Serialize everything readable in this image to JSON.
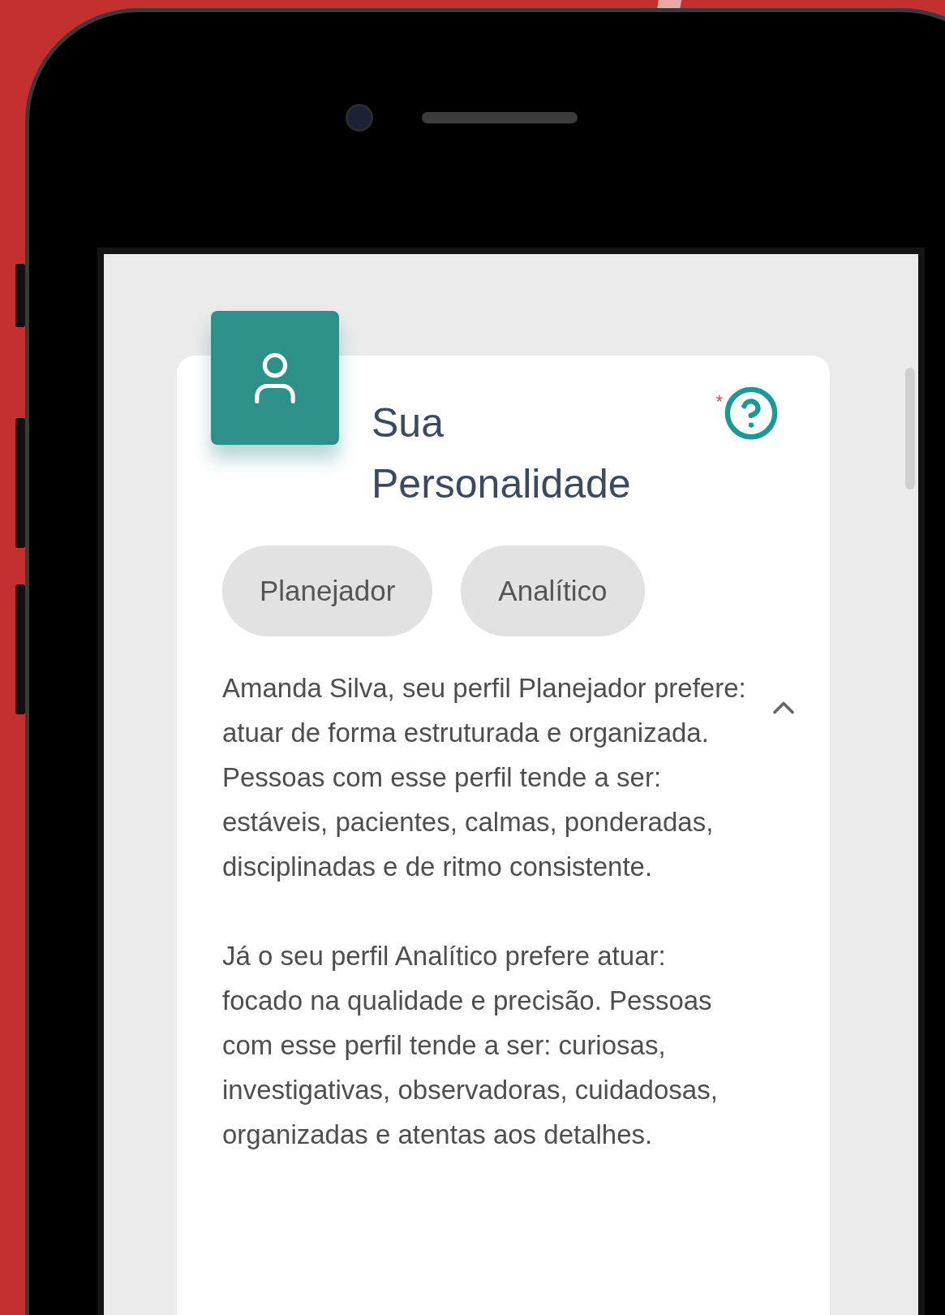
{
  "card": {
    "title": "Sua Personalidade",
    "required_mark": "*",
    "expanded": true,
    "tags": [
      {
        "label": "Planejador"
      },
      {
        "label": "Analítico"
      }
    ],
    "paragraphs": [
      "Amanda Silva, seu perfil Planejador prefere: atuar de forma estruturada e organizada. Pessoas com esse perfil tende a ser: estáveis, pacientes, calmas, ponderadas, disciplinadas e de ritmo consistente.",
      "Já o seu perfil Analítico prefere atuar: focado na qualidade e precisão. Pessoas com esse perfil tende a ser: curiosas, investigativas, observadoras, cuidadosas, organizadas e atentas aos detalhes."
    ]
  }
}
